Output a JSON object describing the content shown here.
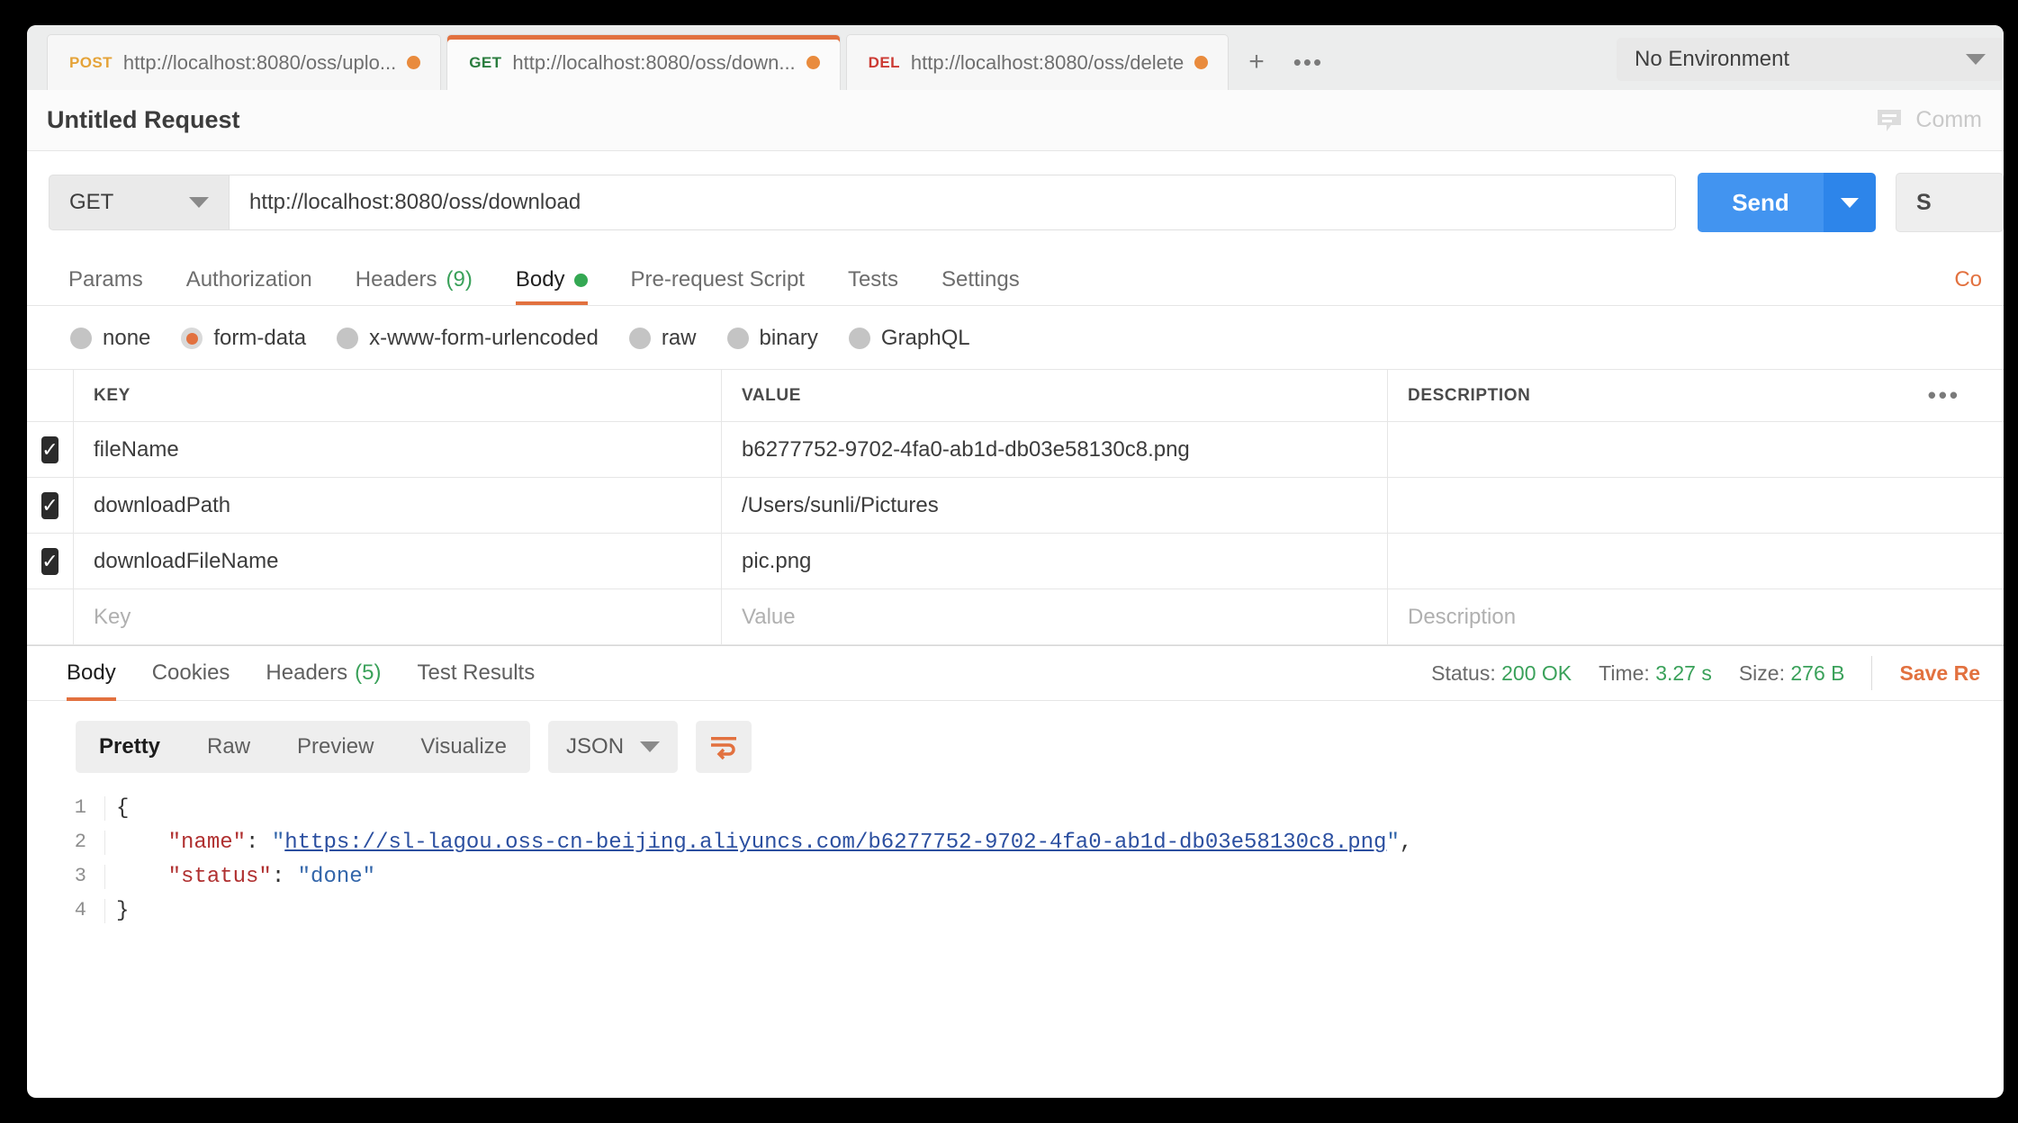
{
  "window": {
    "request_tabs": [
      {
        "verb": "POST",
        "verb_class": "post",
        "url": "http://localhost:8080/oss/uplo...",
        "unsaved": true,
        "active": false
      },
      {
        "verb": "GET",
        "verb_class": "get",
        "url": "http://localhost:8080/oss/down...",
        "unsaved": true,
        "active": true
      },
      {
        "verb": "DEL",
        "verb_class": "del",
        "url": "http://localhost:8080/oss/delete",
        "unsaved": true,
        "active": false
      }
    ],
    "new_tab_label": "+",
    "tab_more_label": "•••",
    "environment": {
      "value": "No Environment"
    }
  },
  "request": {
    "title": "Untitled Request",
    "comments_label": "Comm",
    "method": "GET",
    "url": "http://localhost:8080/oss/download",
    "send_label": "Send",
    "save_label": "S",
    "tabs": [
      {
        "label": "Params",
        "count": "",
        "active": false,
        "dot": false
      },
      {
        "label": "Authorization",
        "count": "",
        "active": false,
        "dot": false
      },
      {
        "label": "Headers",
        "count": "(9)",
        "active": false,
        "dot": false
      },
      {
        "label": "Body",
        "count": "",
        "active": true,
        "dot": true
      },
      {
        "label": "Pre-request Script",
        "count": "",
        "active": false,
        "dot": false
      },
      {
        "label": "Tests",
        "count": "",
        "active": false,
        "dot": false
      },
      {
        "label": "Settings",
        "count": "",
        "active": false,
        "dot": false
      }
    ],
    "code_link": "Co",
    "body_types": [
      {
        "label": "none",
        "selected": false
      },
      {
        "label": "form-data",
        "selected": true
      },
      {
        "label": "x-www-form-urlencoded",
        "selected": false
      },
      {
        "label": "raw",
        "selected": false
      },
      {
        "label": "binary",
        "selected": false
      },
      {
        "label": "GraphQL",
        "selected": false
      }
    ],
    "table": {
      "headers": {
        "key": "KEY",
        "value": "VALUE",
        "description": "DESCRIPTION",
        "more": "•••"
      },
      "rows": [
        {
          "checked": true,
          "key": "fileName",
          "value": "b6277752-9702-4fa0-ab1d-db03e58130c8.png",
          "description": ""
        },
        {
          "checked": true,
          "key": "downloadPath",
          "value": "/Users/sunli/Pictures",
          "description": ""
        },
        {
          "checked": true,
          "key": "downloadFileName",
          "value": "pic.png",
          "description": ""
        }
      ],
      "placeholder_row": {
        "key": "Key",
        "value": "Value",
        "description": "Description"
      }
    }
  },
  "response": {
    "tabs": [
      {
        "label": "Body",
        "count": "",
        "active": true
      },
      {
        "label": "Cookies",
        "count": "",
        "active": false
      },
      {
        "label": "Headers",
        "count": "(5)",
        "active": false
      },
      {
        "label": "Test Results",
        "count": "",
        "active": false
      }
    ],
    "status_label": "Status:",
    "status_value": "200 OK",
    "time_label": "Time:",
    "time_value": "3.27 s",
    "size_label": "Size:",
    "size_value": "276 B",
    "save_response_label": "Save Re",
    "format_tabs": [
      {
        "label": "Pretty",
        "active": true
      },
      {
        "label": "Raw",
        "active": false
      },
      {
        "label": "Preview",
        "active": false
      },
      {
        "label": "Visualize",
        "active": false
      }
    ],
    "format_type": "JSON",
    "body_lines": [
      {
        "no": "1",
        "text": "{"
      },
      {
        "no": "2",
        "text": "    \"name\": \"https://sl-lagou.oss-cn-beijing.aliyuncs.com/b6277752-9702-4fa0-ab1d-db03e58130c8.png\","
      },
      {
        "no": "3",
        "text": "    \"status\": \"done\""
      },
      {
        "no": "4",
        "text": "}"
      }
    ],
    "body_json": {
      "name": "https://sl-lagou.oss-cn-beijing.aliyuncs.com/b6277752-9702-4fa0-ab1d-db03e58130c8.png",
      "status": "done"
    }
  },
  "colors": {
    "accent_orange": "#e2713f",
    "send_blue": "#4294f0",
    "status_green": "#3aa15a",
    "verb_post": "#e5a338",
    "verb_get": "#2a7c3e",
    "verb_del": "#cc3a33"
  }
}
